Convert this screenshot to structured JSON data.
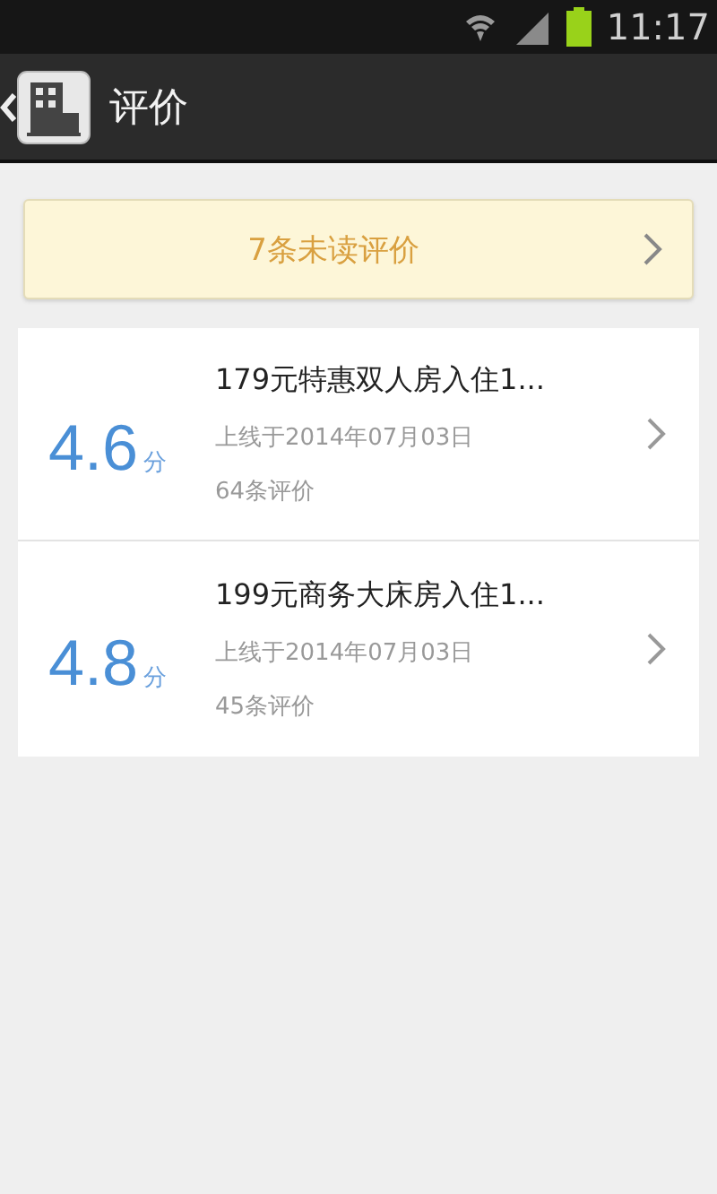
{
  "status_bar": {
    "time": "11:17"
  },
  "app_bar": {
    "title": "评价"
  },
  "unread_banner": {
    "label": "7条未读评价"
  },
  "offers": [
    {
      "score": "4.6",
      "score_unit": "分",
      "title": "179元特惠双人房入住1...",
      "online_date": "上线于2014年07月03日",
      "review_count": "64条评价"
    },
    {
      "score": "4.8",
      "score_unit": "分",
      "title": "199元商务大床房入住1...",
      "online_date": "上线于2014年07月03日",
      "review_count": "45条评价"
    }
  ]
}
